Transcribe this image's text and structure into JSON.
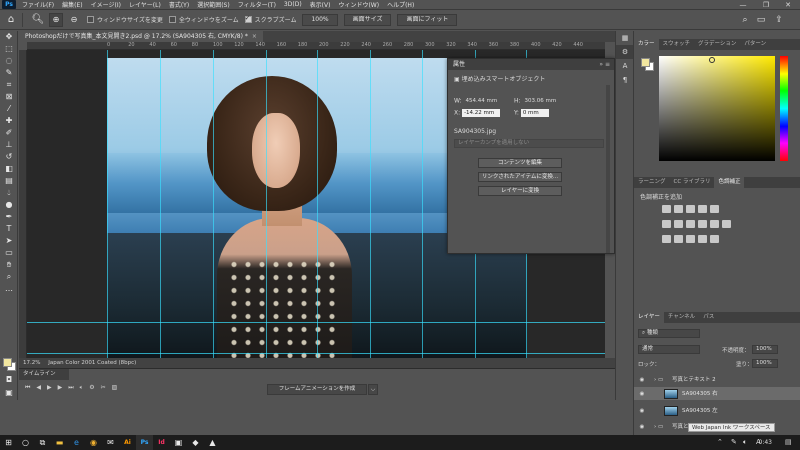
{
  "menubar": {
    "logo": "Ps",
    "items": [
      "ファイル(F)",
      "編集(E)",
      "イメージ(I)",
      "レイヤー(L)",
      "書式(Y)",
      "選択範囲(S)",
      "フィルター(T)",
      "3D(D)",
      "表示(V)",
      "ウィンドウ(W)",
      "ヘルプ(H)"
    ],
    "minimize": "—",
    "restore": "❐",
    "close": "✕"
  },
  "optbar": {
    "checkbox_resize": "ウィンドウサイズを変更",
    "checkbox_all": "全ウィンドウをズーム",
    "checkbox_scrubby": "スクラブズーム",
    "zoom_value": "100%",
    "btn_screen_size": "画面サイズ",
    "btn_fit": "画面にフィット"
  },
  "document": {
    "tab_title": "Photoshopだけで写真集_本文見開き2.psd @ 17.2% (SA904305 右, CMYK/8) *",
    "tab_close": "×",
    "ruler_ticks": [
      "0",
      "20",
      "40",
      "60",
      "80",
      "100",
      "120",
      "140",
      "160",
      "180",
      "200",
      "220",
      "240",
      "260",
      "280",
      "300",
      "320",
      "340",
      "360",
      "380",
      "400",
      "420",
      "440"
    ]
  },
  "properties": {
    "title": "属性",
    "type_label": "埋め込みスマートオブジェクト",
    "w_label": "W:",
    "w_value": "454.44 mm",
    "h_label": "H:",
    "h_value": "303.06 mm",
    "x_label": "X:",
    "x_value": "-14.22 mm",
    "y_label": "Y:",
    "y_value": "0 mm",
    "filename": "SA904305.jpg",
    "layer_comp": "レイヤーカンプを適用しない",
    "btn_edit": "コンテンツを編集",
    "btn_relink": "リンクされたアイテムに変換...",
    "btn_convert": "レイヤーに変換"
  },
  "color_panel": {
    "tabs": [
      "カラー",
      "スウォッチ",
      "グラデーション",
      "パターン"
    ],
    "foreground": "#f2e7a0",
    "background": "#ffffff"
  },
  "adjust_panel": {
    "tabs": [
      "ラーニング",
      "CC ライブラリ",
      "色調補正"
    ],
    "label": "色調補正を追加"
  },
  "layers_panel": {
    "tabs": [
      "レイヤー",
      "チャンネル",
      "パス"
    ],
    "filter_kind": "種類",
    "blend_mode": "通常",
    "opacity_label": "不透明度：",
    "opacity_value": "100%",
    "lock_label": "ロック：",
    "fill_label": "塗り：",
    "fill_value": "100%",
    "layers": [
      {
        "name": "写真とテキスト 2",
        "kind": "folder"
      },
      {
        "name": "SA904305 右",
        "kind": "smart",
        "selected": true
      },
      {
        "name": "SA904305 左",
        "kind": "smart"
      },
      {
        "name": "写真とテキ",
        "kind": "folder"
      }
    ]
  },
  "status": {
    "zoom": "17.2%",
    "profile": "Japan Color 2001 Coated (8bpc)"
  },
  "timeline": {
    "title": "タイムライン",
    "create_btn": "フレームアニメーションを作成",
    "dropdown": "⌵"
  },
  "tooltip": "ワークスペース",
  "tooltip_prefix": "Web Japan Ink",
  "taskbar": {
    "clock": "0:43",
    "lang": "A"
  }
}
